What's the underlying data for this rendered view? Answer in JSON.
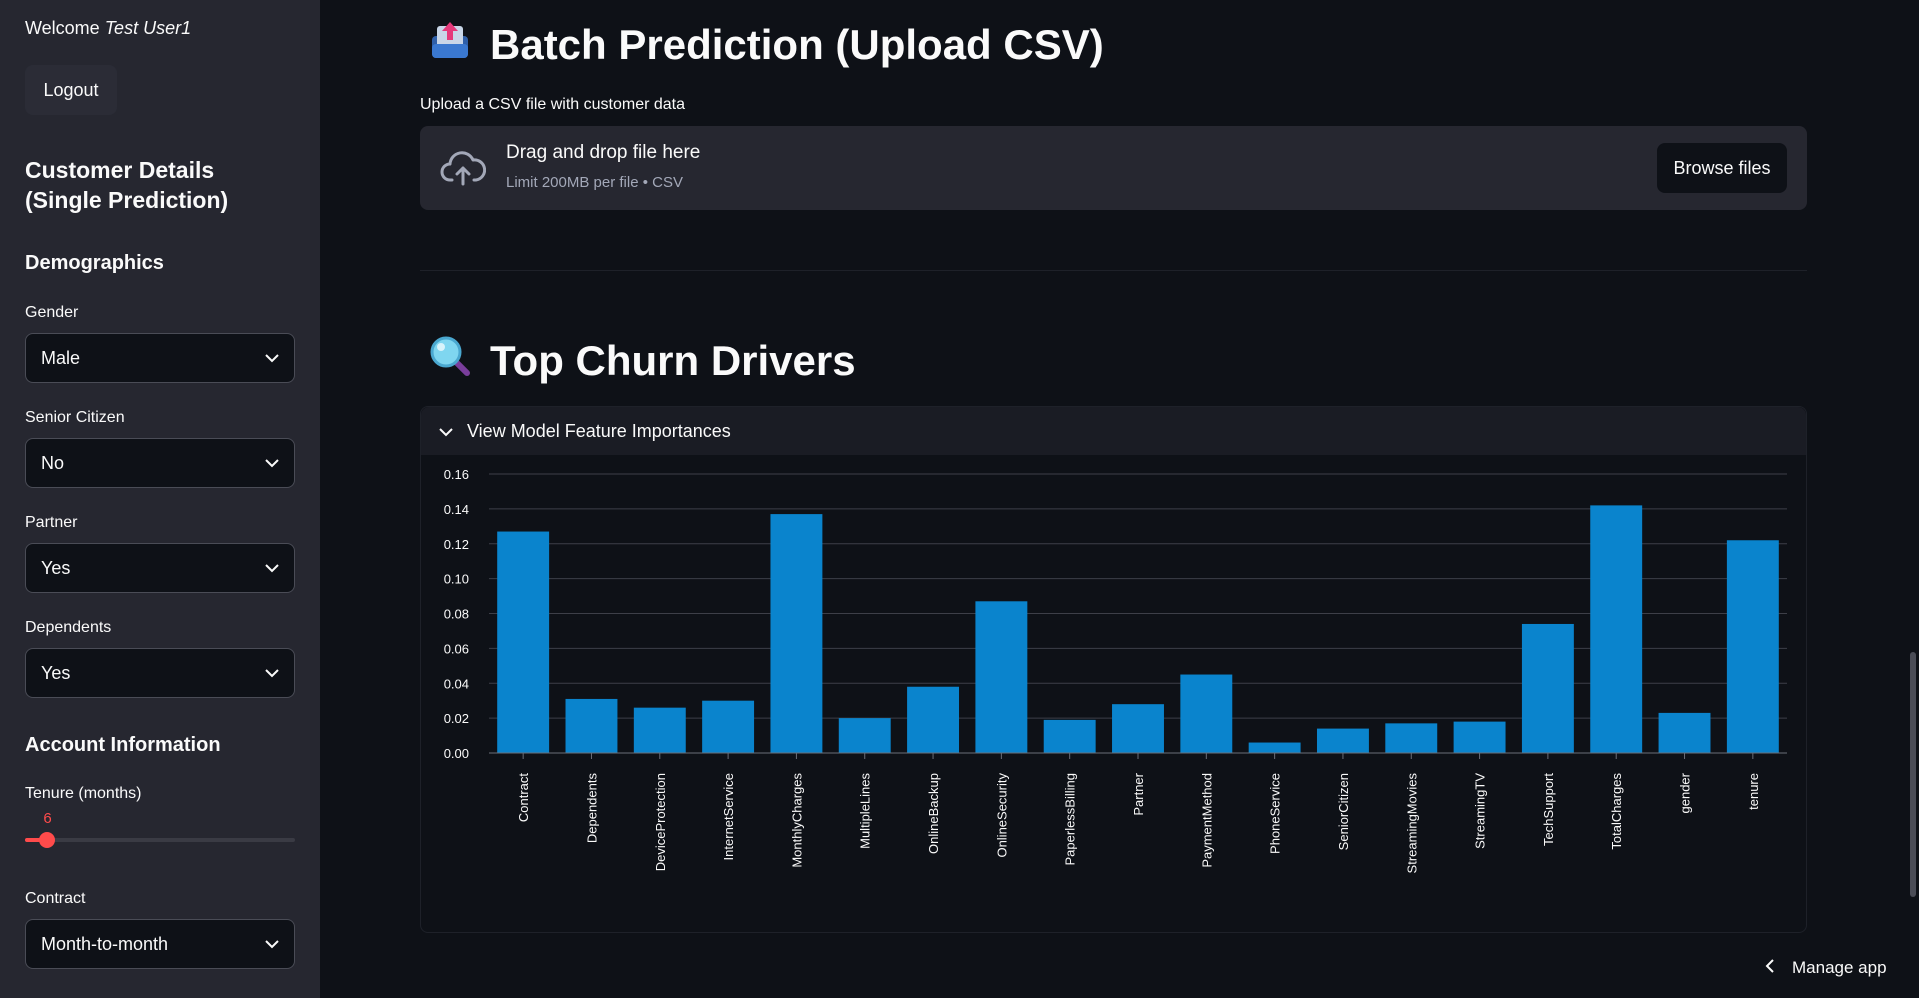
{
  "sidebar": {
    "welcome_prefix": "Welcome",
    "user_name": "Test User1",
    "logout_label": "Logout",
    "title": "Customer Details (Single Prediction)",
    "demographics_heading": "Demographics",
    "gender": {
      "label": "Gender",
      "value": "Male"
    },
    "senior": {
      "label": "Senior Citizen",
      "value": "No"
    },
    "partner": {
      "label": "Partner",
      "value": "Yes"
    },
    "dependents": {
      "label": "Dependents",
      "value": "Yes"
    },
    "account_heading": "Account Information",
    "tenure": {
      "label": "Tenure (months)",
      "value": "6",
      "fraction": 0.083
    },
    "contract": {
      "label": "Contract",
      "value": "Month-to-month"
    }
  },
  "main": {
    "batch_title": "Batch Prediction (Upload CSV)",
    "upload_label": "Upload a CSV file with customer data",
    "dropzone_title": "Drag and drop file here",
    "dropzone_sub": "Limit 200MB per file • CSV",
    "browse_label": "Browse files",
    "drivers_title": "Top Churn Drivers",
    "expander_label": "View Model Feature Importances"
  },
  "footer": {
    "manage_label": "Manage app"
  },
  "colors": {
    "bar": "#0a84cd",
    "accent": "#ff4b4b"
  },
  "chart_data": {
    "type": "bar",
    "categories": [
      "Contract",
      "Dependents",
      "DeviceProtection",
      "InternetService",
      "MonthlyCharges",
      "MultipleLines",
      "OnlineBackup",
      "OnlineSecurity",
      "PaperlessBilling",
      "Partner",
      "PaymentMethod",
      "PhoneService",
      "SeniorCitizen",
      "StreamingMovies",
      "StreamingTV",
      "TechSupport",
      "TotalCharges",
      "gender",
      "tenure"
    ],
    "values": [
      0.127,
      0.031,
      0.026,
      0.03,
      0.137,
      0.02,
      0.038,
      0.087,
      0.019,
      0.028,
      0.045,
      0.006,
      0.014,
      0.017,
      0.018,
      0.074,
      0.142,
      0.023,
      0.122
    ],
    "yticks": [
      "0.00",
      "0.02",
      "0.04",
      "0.06",
      "0.08",
      "0.10",
      "0.12",
      "0.14",
      "0.16"
    ],
    "ylim": [
      0,
      0.16
    ],
    "title": "",
    "xlabel": "",
    "ylabel": "",
    "grid": true
  }
}
